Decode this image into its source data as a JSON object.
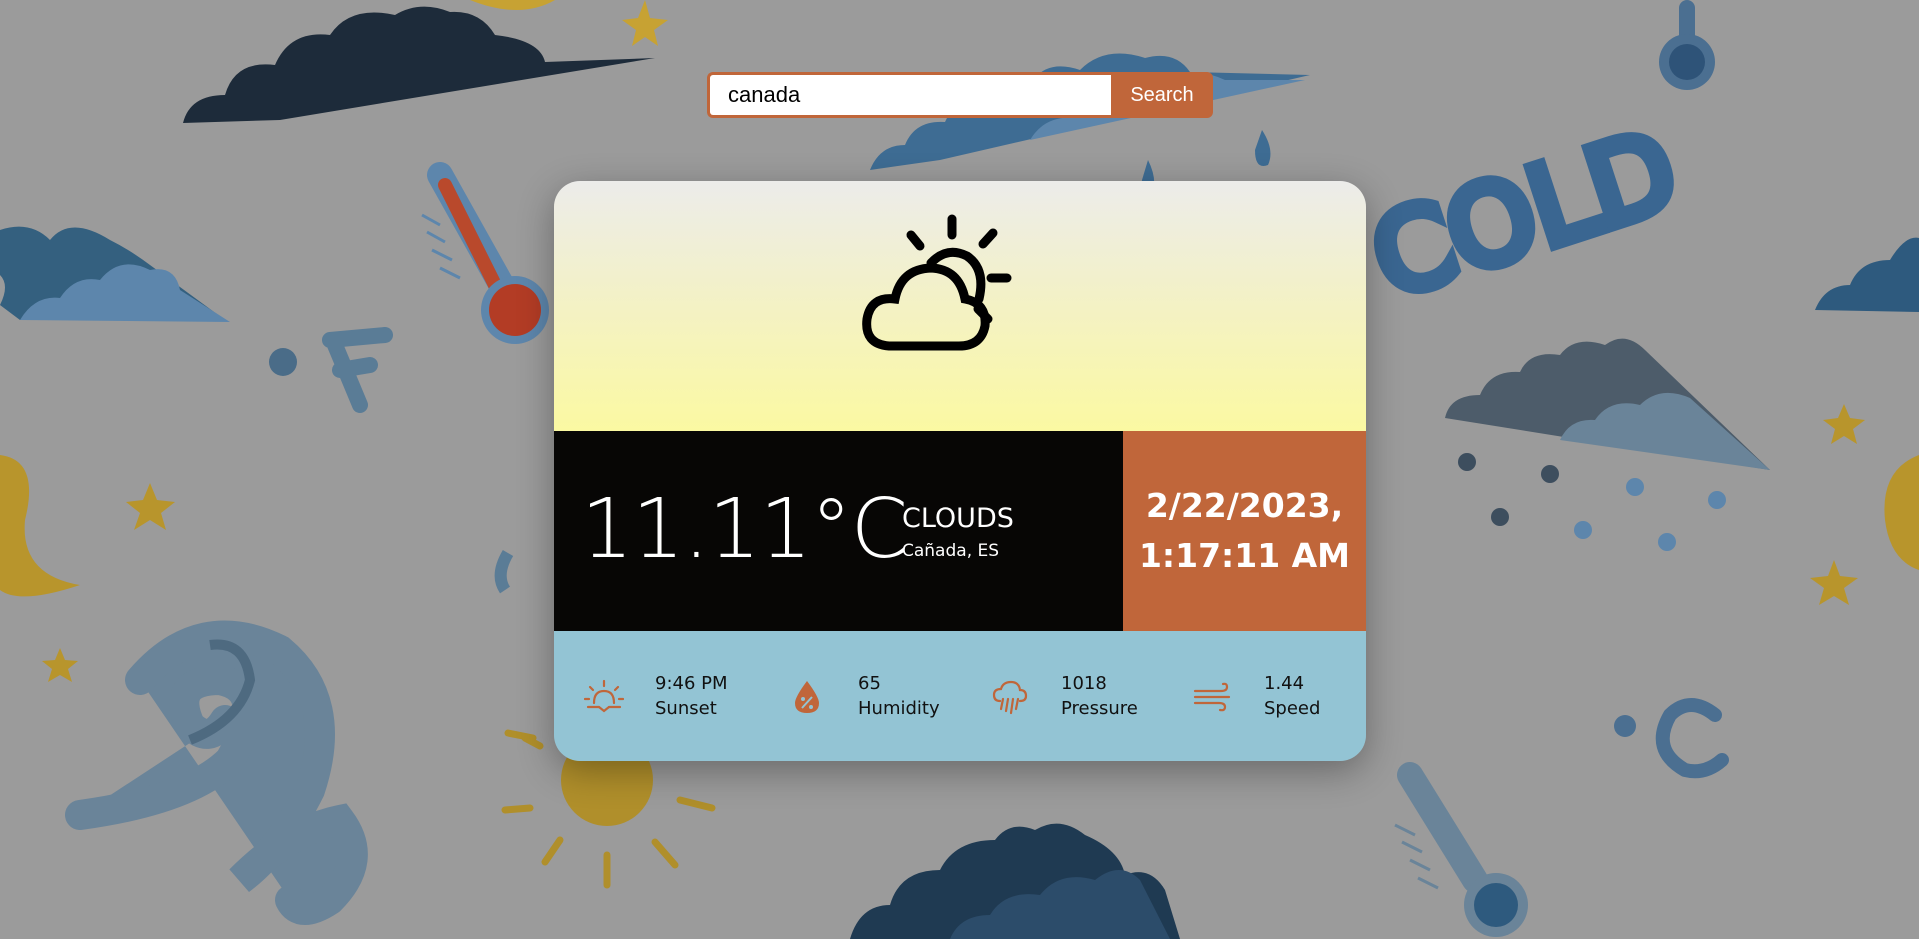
{
  "search": {
    "value": "canada",
    "button_label": "Search"
  },
  "weather": {
    "temperature": "11.11°C",
    "condition": "CLOUDS",
    "location": "Cañada, ES",
    "date": "2/22/2023,",
    "time": "1:17:11 AM",
    "icon": "partly-cloudy-icon"
  },
  "stats": [
    {
      "value": "9:46 PM",
      "label": "Sunset",
      "icon": "sunset-icon"
    },
    {
      "value": "65",
      "label": "Humidity",
      "icon": "humidity-icon"
    },
    {
      "value": "1018",
      "label": "Pressure",
      "icon": "pressure-icon"
    },
    {
      "value": "1.44",
      "label": "Speed",
      "icon": "wind-icon"
    }
  ],
  "background": {
    "text_cold": "COLD",
    "text_f": "°F",
    "text_c": "°C"
  },
  "colors": {
    "accent": "#c0663a",
    "background": "#9b9b9b",
    "stats_panel": "#93c4d4",
    "temp_panel": "#070605"
  }
}
